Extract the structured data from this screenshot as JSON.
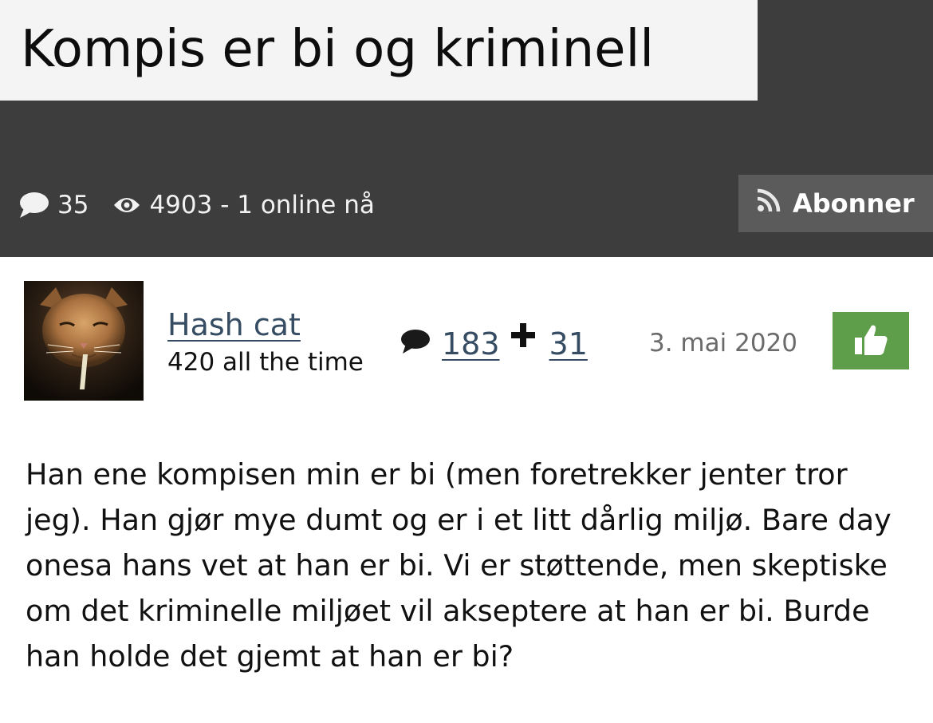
{
  "thread": {
    "title": "Kompis er bi og kriminell",
    "comment_count": "35",
    "views_text": "4903 - 1 online nå",
    "subscribe_label": "Abonner"
  },
  "post": {
    "author": "Hash cat",
    "author_title": "420 all the time",
    "post_count": "183",
    "bonus_count": "31",
    "date": "3. mai 2020",
    "body": "Han ene kompisen min er bi (men foretrekker jenter tror jeg). Han gjør mye dumt og er i et litt dårlig miljø. Bare day onesa hans vet at han er bi. Vi er støttende, men skeptiske om det kriminelle miljøet vil akseptere at han er bi. Burde han holde det gjemt at han er bi?"
  },
  "icons": {
    "comments": "speech-bubble-icon",
    "views": "eye-icon",
    "subscribe": "rss-icon",
    "posts": "speech-bubble-icon",
    "plus": "plus-icon",
    "like": "thumbs-up-icon"
  },
  "colors": {
    "header_bg": "#3d3d3d",
    "title_bg": "#f4f4f4",
    "subscribe_bg": "#5b5b5b",
    "link": "#354c63",
    "like_bg": "#5e9e4b",
    "date": "#6b6b6b"
  }
}
